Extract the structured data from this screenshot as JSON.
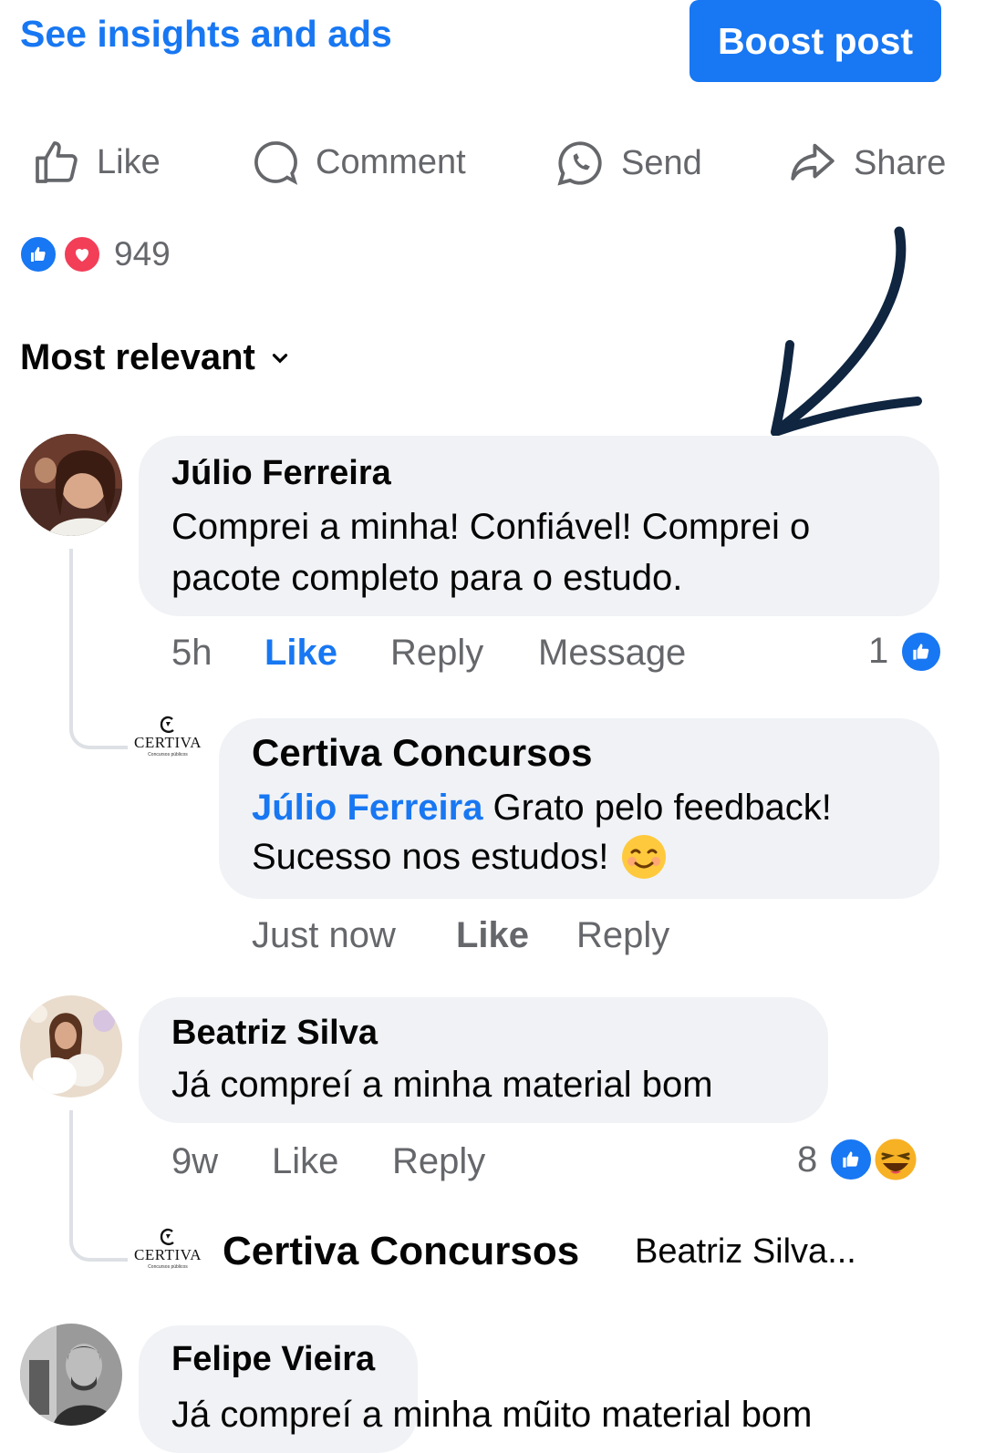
{
  "top": {
    "insights_link": "See insights and ads",
    "boost_button": "Boost post"
  },
  "actions": {
    "like": "Like",
    "comment": "Comment",
    "send": "Send",
    "share": "Share"
  },
  "reactions": {
    "count": "949"
  },
  "sort": {
    "label": "Most relevant"
  },
  "comments": [
    {
      "author": "Júlio Ferreira",
      "text_line1": "Comprei a minha! Confiável! Comprei o",
      "text_line2": "pacote completo para o estudo.",
      "time": "5h",
      "like": "Like",
      "reply": "Reply",
      "message": "Message",
      "reaction_count": "1",
      "reply_item": {
        "author": "Certiva Concursos",
        "mention": "Júlio Ferreira",
        "text_line1": " Grato pelo feedback!",
        "text_line2": "Sucesso nos estudos!",
        "time": "Just now",
        "like": "Like",
        "reply": "Reply"
      }
    },
    {
      "author": "Beatriz Silva",
      "text": "Já compreí a minha material bom",
      "time": "9w",
      "like": "Like",
      "reply": "Reply",
      "reaction_count": "8",
      "reply_preview": {
        "author": "Certiva Concursos",
        "snippet": "Beatriz Silva..."
      }
    },
    {
      "author": "Felipe Vieira",
      "text": "Já compreí a minha mũito material bom"
    }
  ],
  "logo": {
    "word": "CERTIVA",
    "sub": "Concursos públicos"
  },
  "colors": {
    "accent": "#1877f2",
    "bubble": "#f0f2f5",
    "muted": "#65676b",
    "arrow": "#0f2540"
  }
}
